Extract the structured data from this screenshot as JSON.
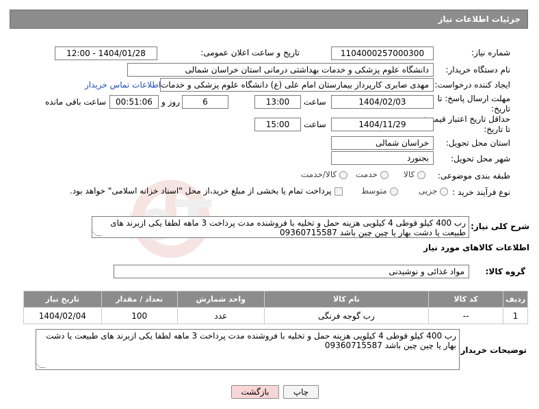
{
  "header": {
    "title": "جزئیات اطلاعات نیاز"
  },
  "fields": {
    "need_number_label": "شماره نیاز:",
    "need_number": "1104000257000300",
    "announce_label": "تاریخ و ساعت اعلان عمومی:",
    "announce_value": "1404/01/28 - 12:00",
    "buyer_org_label": "نام دستگاه خریدار:",
    "buyer_org": "دانشگاه علوم پزشکی و خدمات بهداشتی درمانی استان خراسان شمالی",
    "requester_label": "ایجاد کننده درخواست:",
    "requester": "مهدی صابری کارپرداز بیمارستان امام علی (ع) دانشگاه علوم پزشکی و خدمات ب",
    "buyer_contact_link": "اطلاعات تماس خریدار",
    "reply_deadline_label": "مهلت ارسال پاسخ: تا تاریخ:",
    "reply_date": "1404/02/03",
    "time_label": "ساعت",
    "reply_time": "13:00",
    "days_value": "6",
    "days_label": "روز و",
    "remaining_time": "00:51:06",
    "remaining_label": "ساعت باقی مانده",
    "price_validity_label": "حداقل تاریخ اعتبار قیمت: تا تاریخ:",
    "price_date": "1404/11/29",
    "price_time": "15:00",
    "province_label": "استان محل تحویل:",
    "province": "خراسان شمالی",
    "city_label": "شهر محل تحویل:",
    "city": "بجنورد",
    "category_label": "طبقه بندی موضوعی:",
    "category_options": [
      "کالا",
      "خدمت",
      "کالا/خدمت"
    ],
    "process_label": "نوع فرآیند خرید :",
    "process_options": [
      "جزیی",
      "متوسط"
    ],
    "payment_note": "پرداخت تمام یا بخشی از مبلغ خرید،از محل \"اسناد خزانه اسلامی\" خواهد بود."
  },
  "description": {
    "label": "شرح کلی نیاز:",
    "text": "رب 400 کیلو  قوطی 4 کیلویی  هزینه حمل و تخلیه با فروشنده مدت پرداخت 3 ماهه لطفا یکی ازبرند های طبیعت یا دشت بهار یا چین چین باشد 09360715587"
  },
  "goods_section": {
    "title": "اطلاعات کالاهای مورد نیاز",
    "group_label": "گروه کالا:",
    "group_value": "مواد غذائی و نوشیدنی"
  },
  "table": {
    "headers": [
      "ردیف",
      "کد کالا",
      "نام کالا",
      "واحد شمارش",
      "تعداد / مقدار",
      "تاریخ نیاز"
    ],
    "rows": [
      {
        "row": "1",
        "code": "--",
        "name": "رب گوجه فرنگی",
        "unit": "عدد",
        "qty": "100",
        "date": "1404/02/04"
      }
    ]
  },
  "buyer_notes": {
    "label": "توضیحات خریدار:",
    "text": "رب 400 کیلو  قوطی 4 کیلویی  هزینه حمل و تخلیه با فروشنده مدت پرداخت 3 ماهه لطفا یکی ازبرند های طبیعت یا دشت بهار یا چین چین باشد 09360715587"
  },
  "buttons": {
    "print": "چاپ",
    "back": "بازگشت"
  },
  "colors": {
    "header_bg": "#8c8c8c",
    "back_button_bg": "#f9d6d6",
    "link": "#1f4fbf"
  }
}
